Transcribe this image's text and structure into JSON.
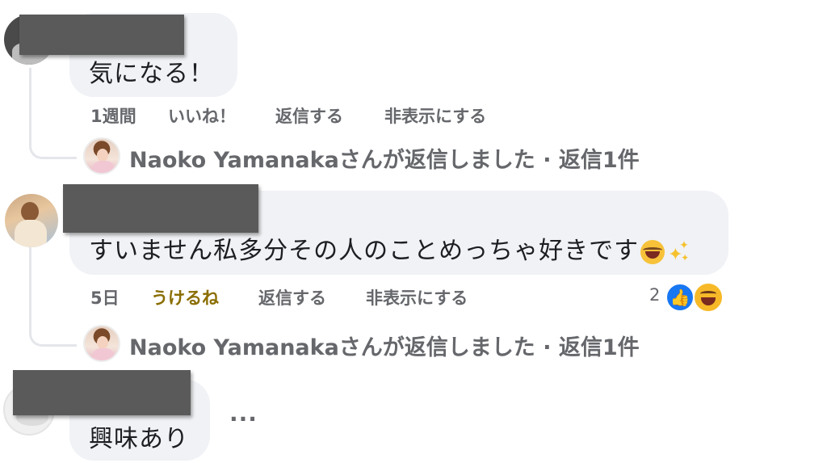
{
  "comments": [
    {
      "text": "気になる！",
      "actions": {
        "time": "1週間",
        "like": "いいね！",
        "reply": "返信する",
        "hide": "非表示にする"
      },
      "reply_summary": "Naoko Yamanakaさんが返信しました · 返信1件"
    },
    {
      "text": "すいません私多分その人のことめっちゃ好きです",
      "emojis": [
        "laughing-tears-emoji",
        "sparkles-emoji"
      ],
      "actions": {
        "time": "5日",
        "like": "うけるね",
        "reply": "返信する",
        "hide": "非表示にする"
      },
      "reactions": {
        "count": "2",
        "types": [
          "like",
          "haha"
        ]
      },
      "reply_summary": "Naoko Yamanakaさんが返信しました · 返信1件"
    },
    {
      "text": "興味あり",
      "more": "···"
    }
  ],
  "colors": {
    "bubble": "#f0f2f5",
    "meta_text": "#65676b",
    "liked_text": "#8a6d00",
    "like_blue": "#1877f2"
  }
}
